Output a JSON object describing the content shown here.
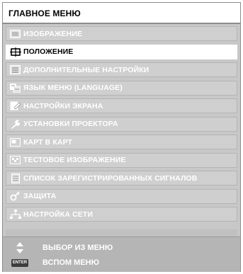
{
  "menu_title": "ГЛАВНОЕ МЕНЮ",
  "items": [
    {
      "label": "ИЗОБРАЖЕНИЕ",
      "icon": "picture-icon"
    },
    {
      "label": "ПОЛОЖЕНИЕ",
      "icon": "position-icon",
      "selected": true
    },
    {
      "label": "ДОПОЛНИТЕЛЬНЫЕ НАСТРОЙКИ",
      "icon": "advanced-settings-icon"
    },
    {
      "label": "ЯЗЫК МЕНЮ (LANGUAGE)",
      "icon": "language-icon"
    },
    {
      "label": "НАСТРОЙКИ ЭКРАНА",
      "icon": "display-settings-icon"
    },
    {
      "label": "УСТАНОВКИ ПРОЕКТОРА",
      "icon": "projector-setup-icon"
    },
    {
      "label": "КАРТ В КАРТ",
      "icon": "picture-in-picture-icon"
    },
    {
      "label": "ТЕСТОВОЕ ИЗОБРАЖЕНИЕ",
      "icon": "test-pattern-icon"
    },
    {
      "label": "СПИСОК ЗАРЕГИСТРИРОВАННЫХ СИГНАЛОВ",
      "icon": "signal-list-icon"
    },
    {
      "label": "ЗАЩИТА",
      "icon": "security-key-icon"
    },
    {
      "label": "НАСТРОЙКА СЕТИ",
      "icon": "network-icon"
    }
  ],
  "footer": {
    "select_hint": "ВЫБОР ИЗ МЕНЮ",
    "enter_hint": "ВСПОМ МЕНЮ",
    "enter_key_text": "ENTER"
  }
}
